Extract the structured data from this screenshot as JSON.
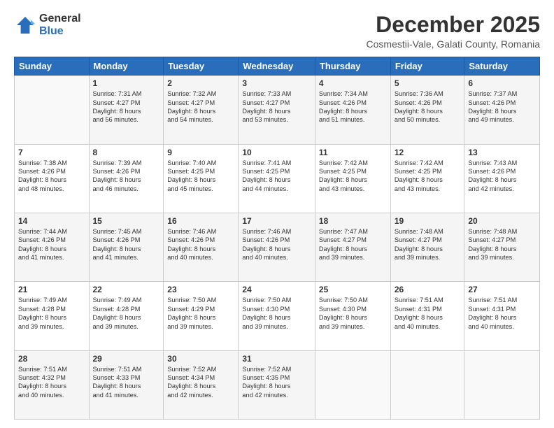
{
  "logo": {
    "general": "General",
    "blue": "Blue"
  },
  "title": "December 2025",
  "location": "Cosmestii-Vale, Galati County, Romania",
  "days_of_week": [
    "Sunday",
    "Monday",
    "Tuesday",
    "Wednesday",
    "Thursday",
    "Friday",
    "Saturday"
  ],
  "weeks": [
    [
      {
        "day": "",
        "info": ""
      },
      {
        "day": "1",
        "info": "Sunrise: 7:31 AM\nSunset: 4:27 PM\nDaylight: 8 hours\nand 56 minutes."
      },
      {
        "day": "2",
        "info": "Sunrise: 7:32 AM\nSunset: 4:27 PM\nDaylight: 8 hours\nand 54 minutes."
      },
      {
        "day": "3",
        "info": "Sunrise: 7:33 AM\nSunset: 4:27 PM\nDaylight: 8 hours\nand 53 minutes."
      },
      {
        "day": "4",
        "info": "Sunrise: 7:34 AM\nSunset: 4:26 PM\nDaylight: 8 hours\nand 51 minutes."
      },
      {
        "day": "5",
        "info": "Sunrise: 7:36 AM\nSunset: 4:26 PM\nDaylight: 8 hours\nand 50 minutes."
      },
      {
        "day": "6",
        "info": "Sunrise: 7:37 AM\nSunset: 4:26 PM\nDaylight: 8 hours\nand 49 minutes."
      }
    ],
    [
      {
        "day": "7",
        "info": "Sunrise: 7:38 AM\nSunset: 4:26 PM\nDaylight: 8 hours\nand 48 minutes."
      },
      {
        "day": "8",
        "info": "Sunrise: 7:39 AM\nSunset: 4:26 PM\nDaylight: 8 hours\nand 46 minutes."
      },
      {
        "day": "9",
        "info": "Sunrise: 7:40 AM\nSunset: 4:25 PM\nDaylight: 8 hours\nand 45 minutes."
      },
      {
        "day": "10",
        "info": "Sunrise: 7:41 AM\nSunset: 4:25 PM\nDaylight: 8 hours\nand 44 minutes."
      },
      {
        "day": "11",
        "info": "Sunrise: 7:42 AM\nSunset: 4:25 PM\nDaylight: 8 hours\nand 43 minutes."
      },
      {
        "day": "12",
        "info": "Sunrise: 7:42 AM\nSunset: 4:25 PM\nDaylight: 8 hours\nand 43 minutes."
      },
      {
        "day": "13",
        "info": "Sunrise: 7:43 AM\nSunset: 4:26 PM\nDaylight: 8 hours\nand 42 minutes."
      }
    ],
    [
      {
        "day": "14",
        "info": "Sunrise: 7:44 AM\nSunset: 4:26 PM\nDaylight: 8 hours\nand 41 minutes."
      },
      {
        "day": "15",
        "info": "Sunrise: 7:45 AM\nSunset: 4:26 PM\nDaylight: 8 hours\nand 41 minutes."
      },
      {
        "day": "16",
        "info": "Sunrise: 7:46 AM\nSunset: 4:26 PM\nDaylight: 8 hours\nand 40 minutes."
      },
      {
        "day": "17",
        "info": "Sunrise: 7:46 AM\nSunset: 4:26 PM\nDaylight: 8 hours\nand 40 minutes."
      },
      {
        "day": "18",
        "info": "Sunrise: 7:47 AM\nSunset: 4:27 PM\nDaylight: 8 hours\nand 39 minutes."
      },
      {
        "day": "19",
        "info": "Sunrise: 7:48 AM\nSunset: 4:27 PM\nDaylight: 8 hours\nand 39 minutes."
      },
      {
        "day": "20",
        "info": "Sunrise: 7:48 AM\nSunset: 4:27 PM\nDaylight: 8 hours\nand 39 minutes."
      }
    ],
    [
      {
        "day": "21",
        "info": "Sunrise: 7:49 AM\nSunset: 4:28 PM\nDaylight: 8 hours\nand 39 minutes."
      },
      {
        "day": "22",
        "info": "Sunrise: 7:49 AM\nSunset: 4:28 PM\nDaylight: 8 hours\nand 39 minutes."
      },
      {
        "day": "23",
        "info": "Sunrise: 7:50 AM\nSunset: 4:29 PM\nDaylight: 8 hours\nand 39 minutes."
      },
      {
        "day": "24",
        "info": "Sunrise: 7:50 AM\nSunset: 4:30 PM\nDaylight: 8 hours\nand 39 minutes."
      },
      {
        "day": "25",
        "info": "Sunrise: 7:50 AM\nSunset: 4:30 PM\nDaylight: 8 hours\nand 39 minutes."
      },
      {
        "day": "26",
        "info": "Sunrise: 7:51 AM\nSunset: 4:31 PM\nDaylight: 8 hours\nand 40 minutes."
      },
      {
        "day": "27",
        "info": "Sunrise: 7:51 AM\nSunset: 4:31 PM\nDaylight: 8 hours\nand 40 minutes."
      }
    ],
    [
      {
        "day": "28",
        "info": "Sunrise: 7:51 AM\nSunset: 4:32 PM\nDaylight: 8 hours\nand 40 minutes."
      },
      {
        "day": "29",
        "info": "Sunrise: 7:51 AM\nSunset: 4:33 PM\nDaylight: 8 hours\nand 41 minutes."
      },
      {
        "day": "30",
        "info": "Sunrise: 7:52 AM\nSunset: 4:34 PM\nDaylight: 8 hours\nand 42 minutes."
      },
      {
        "day": "31",
        "info": "Sunrise: 7:52 AM\nSunset: 4:35 PM\nDaylight: 8 hours\nand 42 minutes."
      },
      {
        "day": "",
        "info": ""
      },
      {
        "day": "",
        "info": ""
      },
      {
        "day": "",
        "info": ""
      }
    ]
  ]
}
